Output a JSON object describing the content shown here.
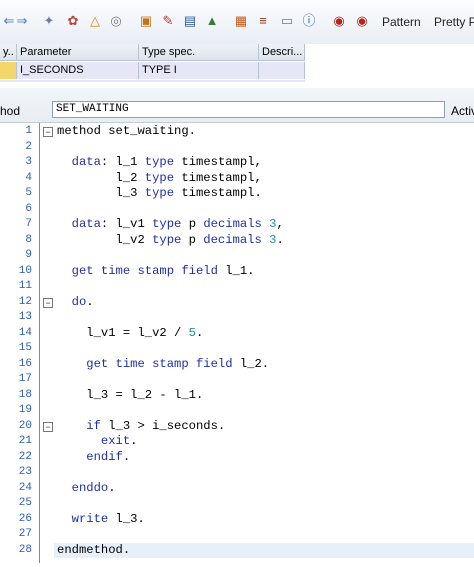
{
  "toolbar": {
    "icons": [
      "left-arrow-icon",
      "right-arrow-icon",
      "display-object-icon",
      "check-icon",
      "activate-icon",
      "test-icon",
      "where-used-icon",
      "hierarchy-icon",
      "tools-icon",
      "navigation-icon",
      "object-list-icon",
      "enhance-icon",
      "layout-icon",
      "help-icon",
      "info-icon",
      "breakpoint-icon",
      "external-breakpoint-icon"
    ],
    "pattern_label": "Pattern",
    "pretty_label": "Pretty P"
  },
  "params": {
    "headers": [
      "y..",
      "Parameter",
      "Type spec.",
      "Descri..."
    ],
    "rows": [
      {
        "type": "",
        "name": "I_SECONDS",
        "spec": "TYPE I",
        "desc": ""
      }
    ]
  },
  "method": {
    "label": "hod",
    "value": "SET_WAITING",
    "extra": "Activ"
  },
  "code": {
    "current_line": 28,
    "lines": [
      [
        {
          "t": "method set_waiting.",
          "c": ""
        }
      ],
      [],
      [
        {
          "t": "  ",
          "c": ""
        },
        {
          "t": "data",
          "c": "kw"
        },
        {
          "t": ": l_1 ",
          "c": ""
        },
        {
          "t": "type",
          "c": "kw"
        },
        {
          "t": " timestampl,",
          "c": ""
        }
      ],
      [
        {
          "t": "        l_2 ",
          "c": ""
        },
        {
          "t": "type",
          "c": "kw"
        },
        {
          "t": " timestampl,",
          "c": ""
        }
      ],
      [
        {
          "t": "        l_3 ",
          "c": ""
        },
        {
          "t": "type",
          "c": "kw"
        },
        {
          "t": " timestampl.",
          "c": ""
        }
      ],
      [],
      [
        {
          "t": "  ",
          "c": ""
        },
        {
          "t": "data",
          "c": "kw"
        },
        {
          "t": ": l_v1 ",
          "c": ""
        },
        {
          "t": "type",
          "c": "kw"
        },
        {
          "t": " p ",
          "c": ""
        },
        {
          "t": "decimals",
          "c": "kw"
        },
        {
          "t": " ",
          "c": ""
        },
        {
          "t": "3",
          "c": "num"
        },
        {
          "t": ",",
          "c": ""
        }
      ],
      [
        {
          "t": "        l_v2 ",
          "c": ""
        },
        {
          "t": "type",
          "c": "kw"
        },
        {
          "t": " p ",
          "c": ""
        },
        {
          "t": "decimals",
          "c": "kw"
        },
        {
          "t": " ",
          "c": ""
        },
        {
          "t": "3",
          "c": "num"
        },
        {
          "t": ".",
          "c": ""
        }
      ],
      [],
      [
        {
          "t": "  ",
          "c": ""
        },
        {
          "t": "get time stamp field",
          "c": "kw"
        },
        {
          "t": " l_1.",
          "c": ""
        }
      ],
      [],
      [
        {
          "t": "  ",
          "c": ""
        },
        {
          "t": "do",
          "c": "kw"
        },
        {
          "t": ".",
          "c": ""
        }
      ],
      [],
      [
        {
          "t": "    l_v1 = l_v2 / ",
          "c": ""
        },
        {
          "t": "5",
          "c": "num"
        },
        {
          "t": ".",
          "c": ""
        }
      ],
      [],
      [
        {
          "t": "    ",
          "c": ""
        },
        {
          "t": "get time stamp field",
          "c": "kw"
        },
        {
          "t": " l_2.",
          "c": ""
        }
      ],
      [],
      [
        {
          "t": "    l_3 = l_2 - l_1.",
          "c": ""
        }
      ],
      [],
      [
        {
          "t": "    ",
          "c": ""
        },
        {
          "t": "if",
          "c": "kw"
        },
        {
          "t": " l_3 > i_seconds.",
          "c": ""
        }
      ],
      [
        {
          "t": "      ",
          "c": ""
        },
        {
          "t": "exit",
          "c": "kw"
        },
        {
          "t": ".",
          "c": ""
        }
      ],
      [
        {
          "t": "    ",
          "c": ""
        },
        {
          "t": "endif",
          "c": "kw"
        },
        {
          "t": ".",
          "c": ""
        }
      ],
      [],
      [
        {
          "t": "  ",
          "c": ""
        },
        {
          "t": "enddo",
          "c": "kw"
        },
        {
          "t": ".",
          "c": ""
        }
      ],
      [],
      [
        {
          "t": "  ",
          "c": ""
        },
        {
          "t": "write",
          "c": "kw"
        },
        {
          "t": " l_3.",
          "c": ""
        }
      ],
      [],
      [
        {
          "t": "endmethod.",
          "c": ""
        }
      ]
    ],
    "folds": [
      1,
      12,
      20
    ]
  },
  "colors": {
    "keyword": "#1f2fa8",
    "number": "#1f8f9f",
    "line_number": "#2a5db0",
    "param_row": "#e6e7f6",
    "selected_cell": "#f3d76c"
  }
}
